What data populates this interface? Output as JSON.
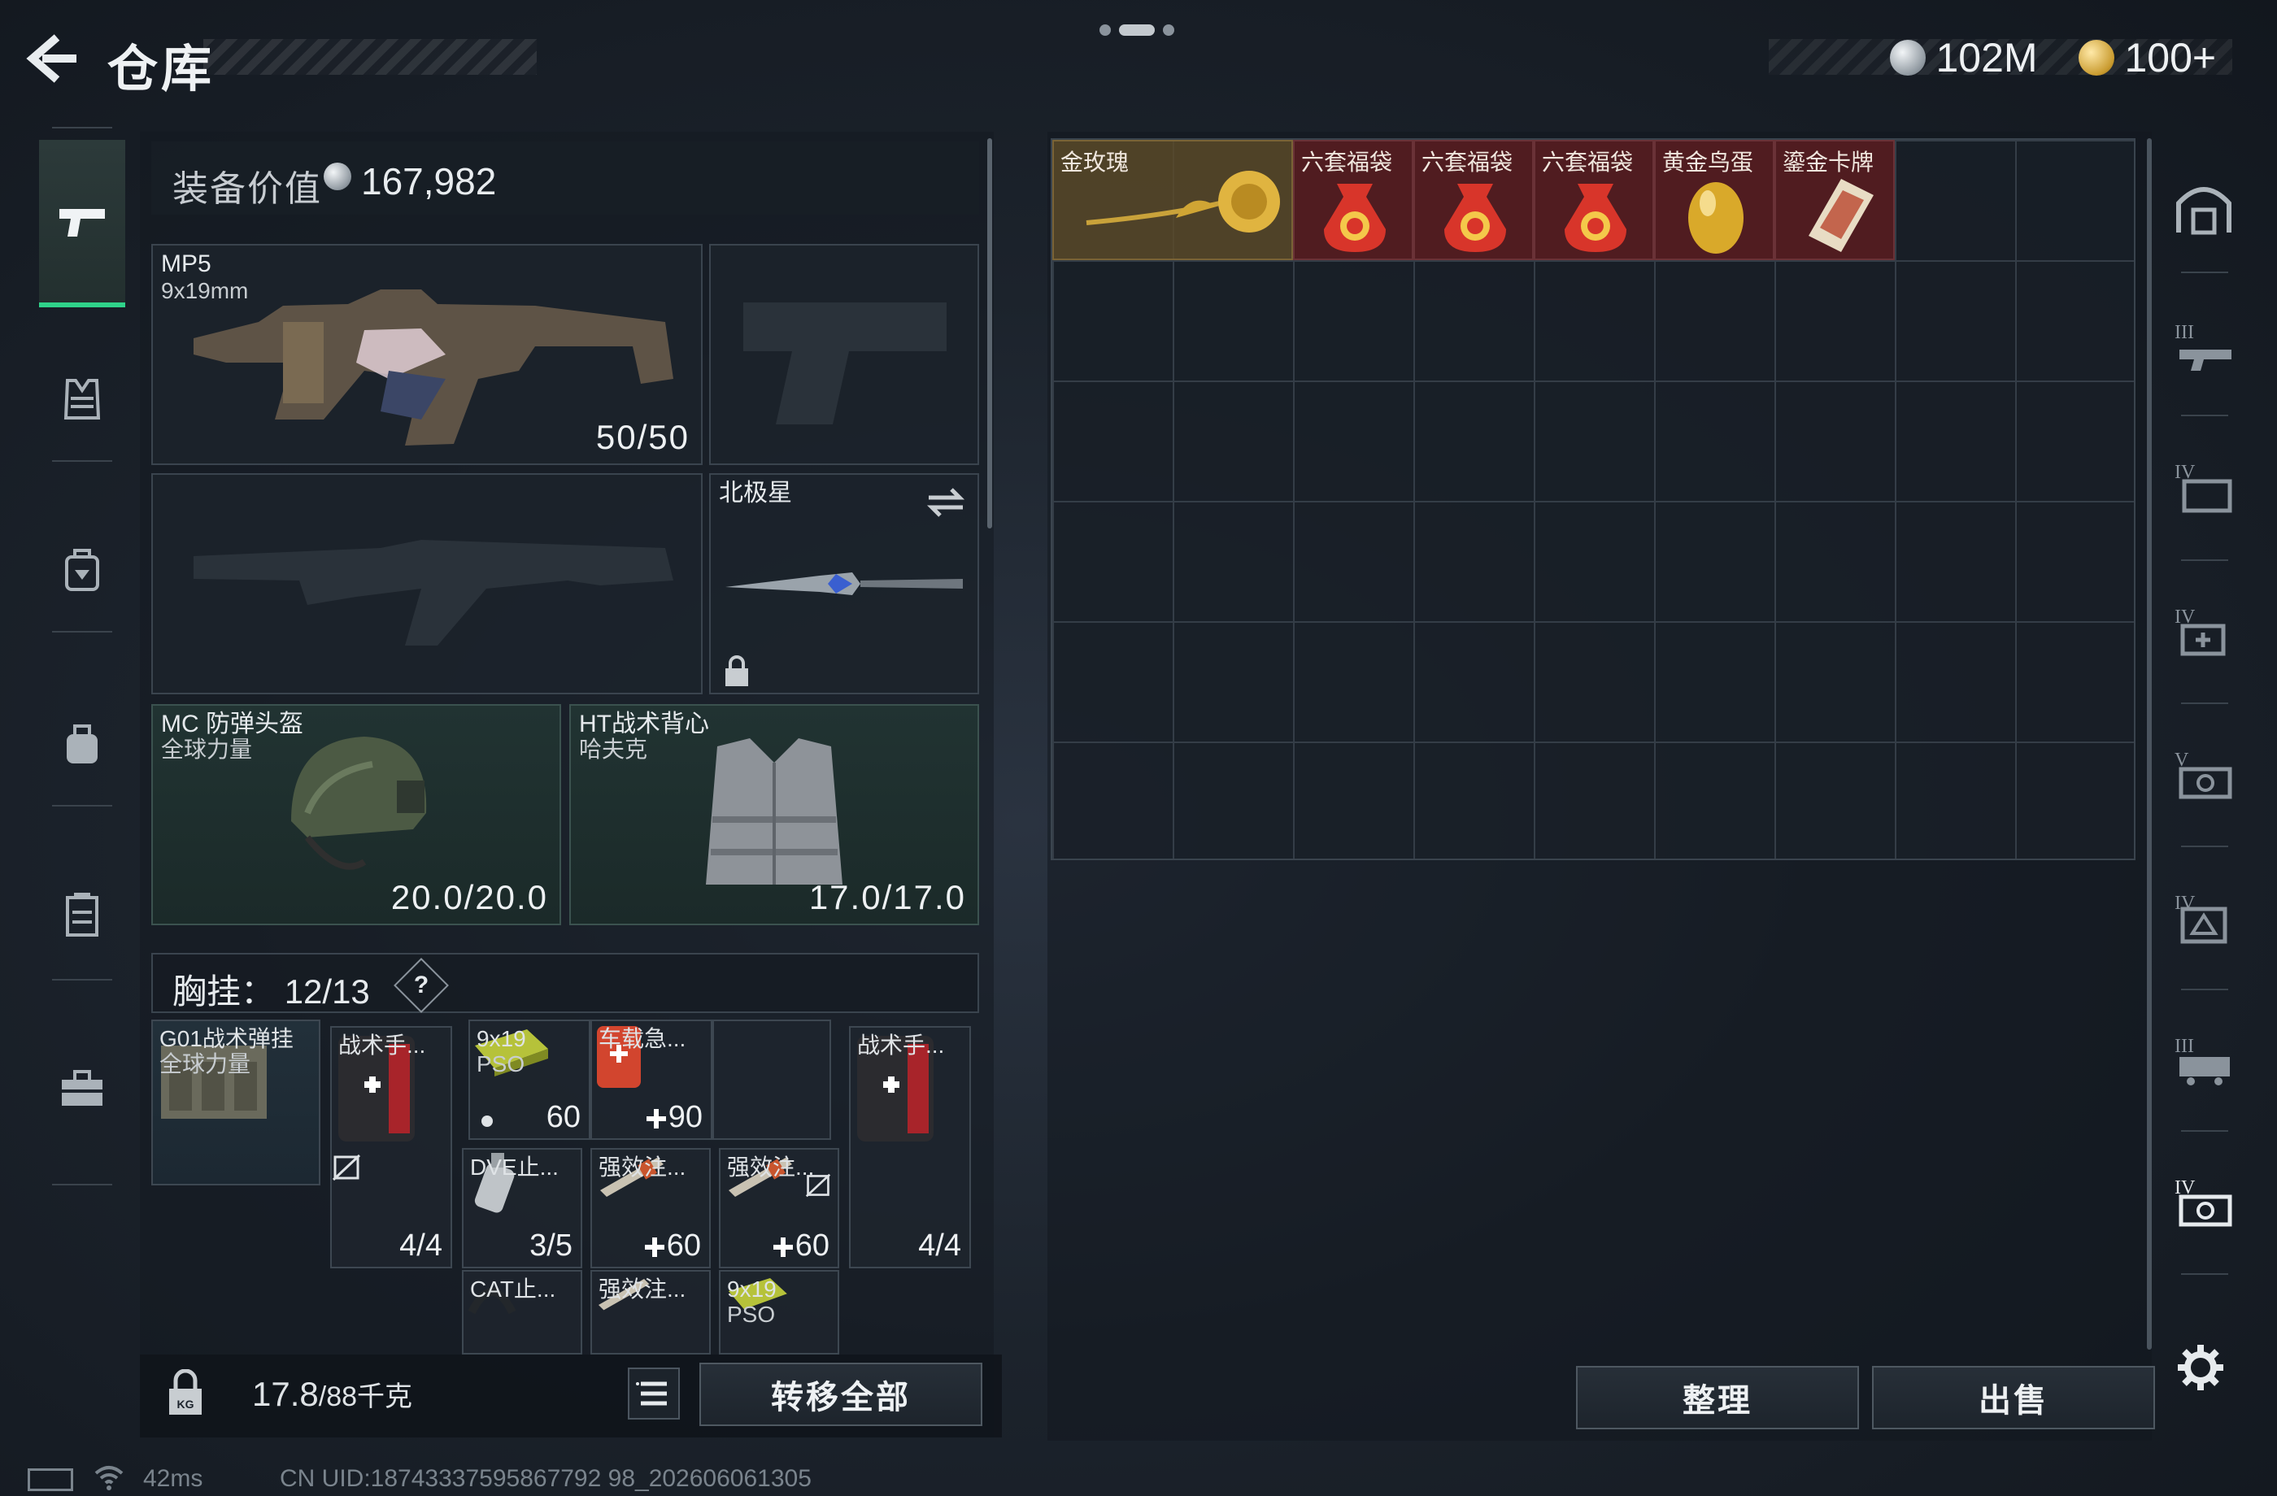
{
  "header": {
    "title": "仓库",
    "currency_silver": "102M",
    "currency_gold": "100+"
  },
  "loadout": {
    "value_label": "装备价值",
    "value": "167,982",
    "primary": {
      "name": "MP5",
      "caliber": "9x19mm",
      "ammo": "50/50"
    },
    "melee": {
      "name": "北极星"
    },
    "helmet": {
      "name": "MC 防弹头盔",
      "brand": "全球力量",
      "durability": "20.0/20.0"
    },
    "armor": {
      "name": "HT战术背心",
      "brand": "哈夫克",
      "durability": "17.0/17.0"
    },
    "chest_rig": {
      "label": "胸挂：",
      "capacity": "12/13",
      "help": "?",
      "rig_name": "G01战术弹挂",
      "rig_brand": "全球力量",
      "items": [
        {
          "name": "战术手...",
          "count": "4/4"
        },
        {
          "name": "9x19",
          "sub": "PSO",
          "count": "60"
        },
        {
          "name": "车载急...",
          "count": "90"
        },
        {
          "name": "战术手...",
          "count": "4/4"
        },
        {
          "name": "DVE止...",
          "count": "3/5"
        },
        {
          "name": "强效注...",
          "count": "60"
        },
        {
          "name": "强效注...",
          "count": "60"
        },
        {
          "name": "CAT止...",
          "count": ""
        },
        {
          "name": "强效注...",
          "count": ""
        },
        {
          "name": "9x19",
          "sub": "PSO",
          "count": ""
        }
      ]
    },
    "weight": "17.8",
    "weight_max": "/88千克",
    "transfer_all": "转移全部"
  },
  "stash": {
    "items": [
      {
        "name": "金玫瑰",
        "icon": "golden-rose-icon",
        "tier": "gold"
      },
      {
        "name": "六套福袋",
        "icon": "lucky-bag-icon",
        "tier": "red"
      },
      {
        "name": "六套福袋",
        "icon": "lucky-bag-icon",
        "tier": "red"
      },
      {
        "name": "六套福袋",
        "icon": "lucky-bag-icon",
        "tier": "red"
      },
      {
        "name": "黄金鸟蛋",
        "icon": "golden-egg-icon",
        "tier": "red"
      },
      {
        "name": "鎏金卡牌",
        "icon": "gilded-card-icon",
        "tier": "red"
      }
    ],
    "sort_button": "整理",
    "sell_button": "出售"
  },
  "status": {
    "ping": "42ms",
    "uid": "CN UID:18743337595867792 98_202606061305"
  },
  "colors": {
    "accent_green": "#2fd38a",
    "rare_red": "#5a1c20",
    "legendary_gold": "#5c4a28"
  }
}
